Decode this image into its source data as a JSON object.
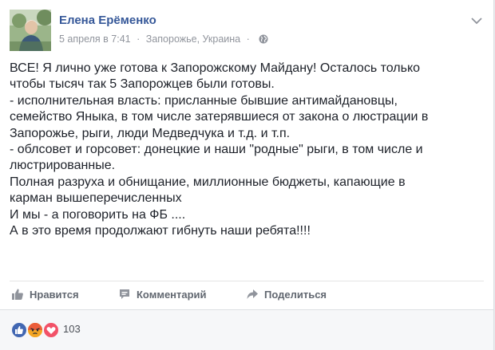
{
  "post": {
    "author": "Елена Ерёменко",
    "date": "5 апреля в 7:41",
    "separator": "·",
    "location": "Запорожье, Украина",
    "location_separator": "·",
    "privacy_icon": "globe-icon",
    "menu_icon": "chevron-down-icon",
    "text_lines": [
      "ВСЕ! Я лично уже готова к Запорожскому Майдану! Осталось только",
      "чтобы тысяч так 5 Запорожцев были готовы.",
      "- исполнительная власть: присланные бывшие антимайдановцы,",
      "семейство Яныка, в том числе затерявшиеся от закона о люстрации в",
      "Запорожье, рыги, люди Медведчука и т.д. и т.п.",
      "- облсовет и горсовет: донецкие и наши \"родные\" рыги, в том числе и",
      "люстрированные.",
      "Полная разруха и обнищание, миллионные бюджеты, капающие в",
      "карман вышеперечисленных",
      "И мы - а поговорить на ФБ ....",
      "А в это время продолжают гибнуть наши ребята!!!!"
    ]
  },
  "actions": {
    "like_label": "Нравится",
    "like_icon": "thumbs-up-icon",
    "comment_label": "Комментарий",
    "comment_icon": "comment-icon",
    "share_label": "Поделиться",
    "share_icon": "share-arrow-icon"
  },
  "reactions": {
    "icons": [
      "like-reaction-icon",
      "angry-reaction-icon",
      "love-reaction-icon"
    ],
    "count": "103"
  },
  "colors": {
    "author": "#365899",
    "meta": "#90949c",
    "text": "#1d2129",
    "action": "#616770",
    "like": "#4267b2",
    "angry": "#f5a623",
    "love": "#f25268"
  }
}
